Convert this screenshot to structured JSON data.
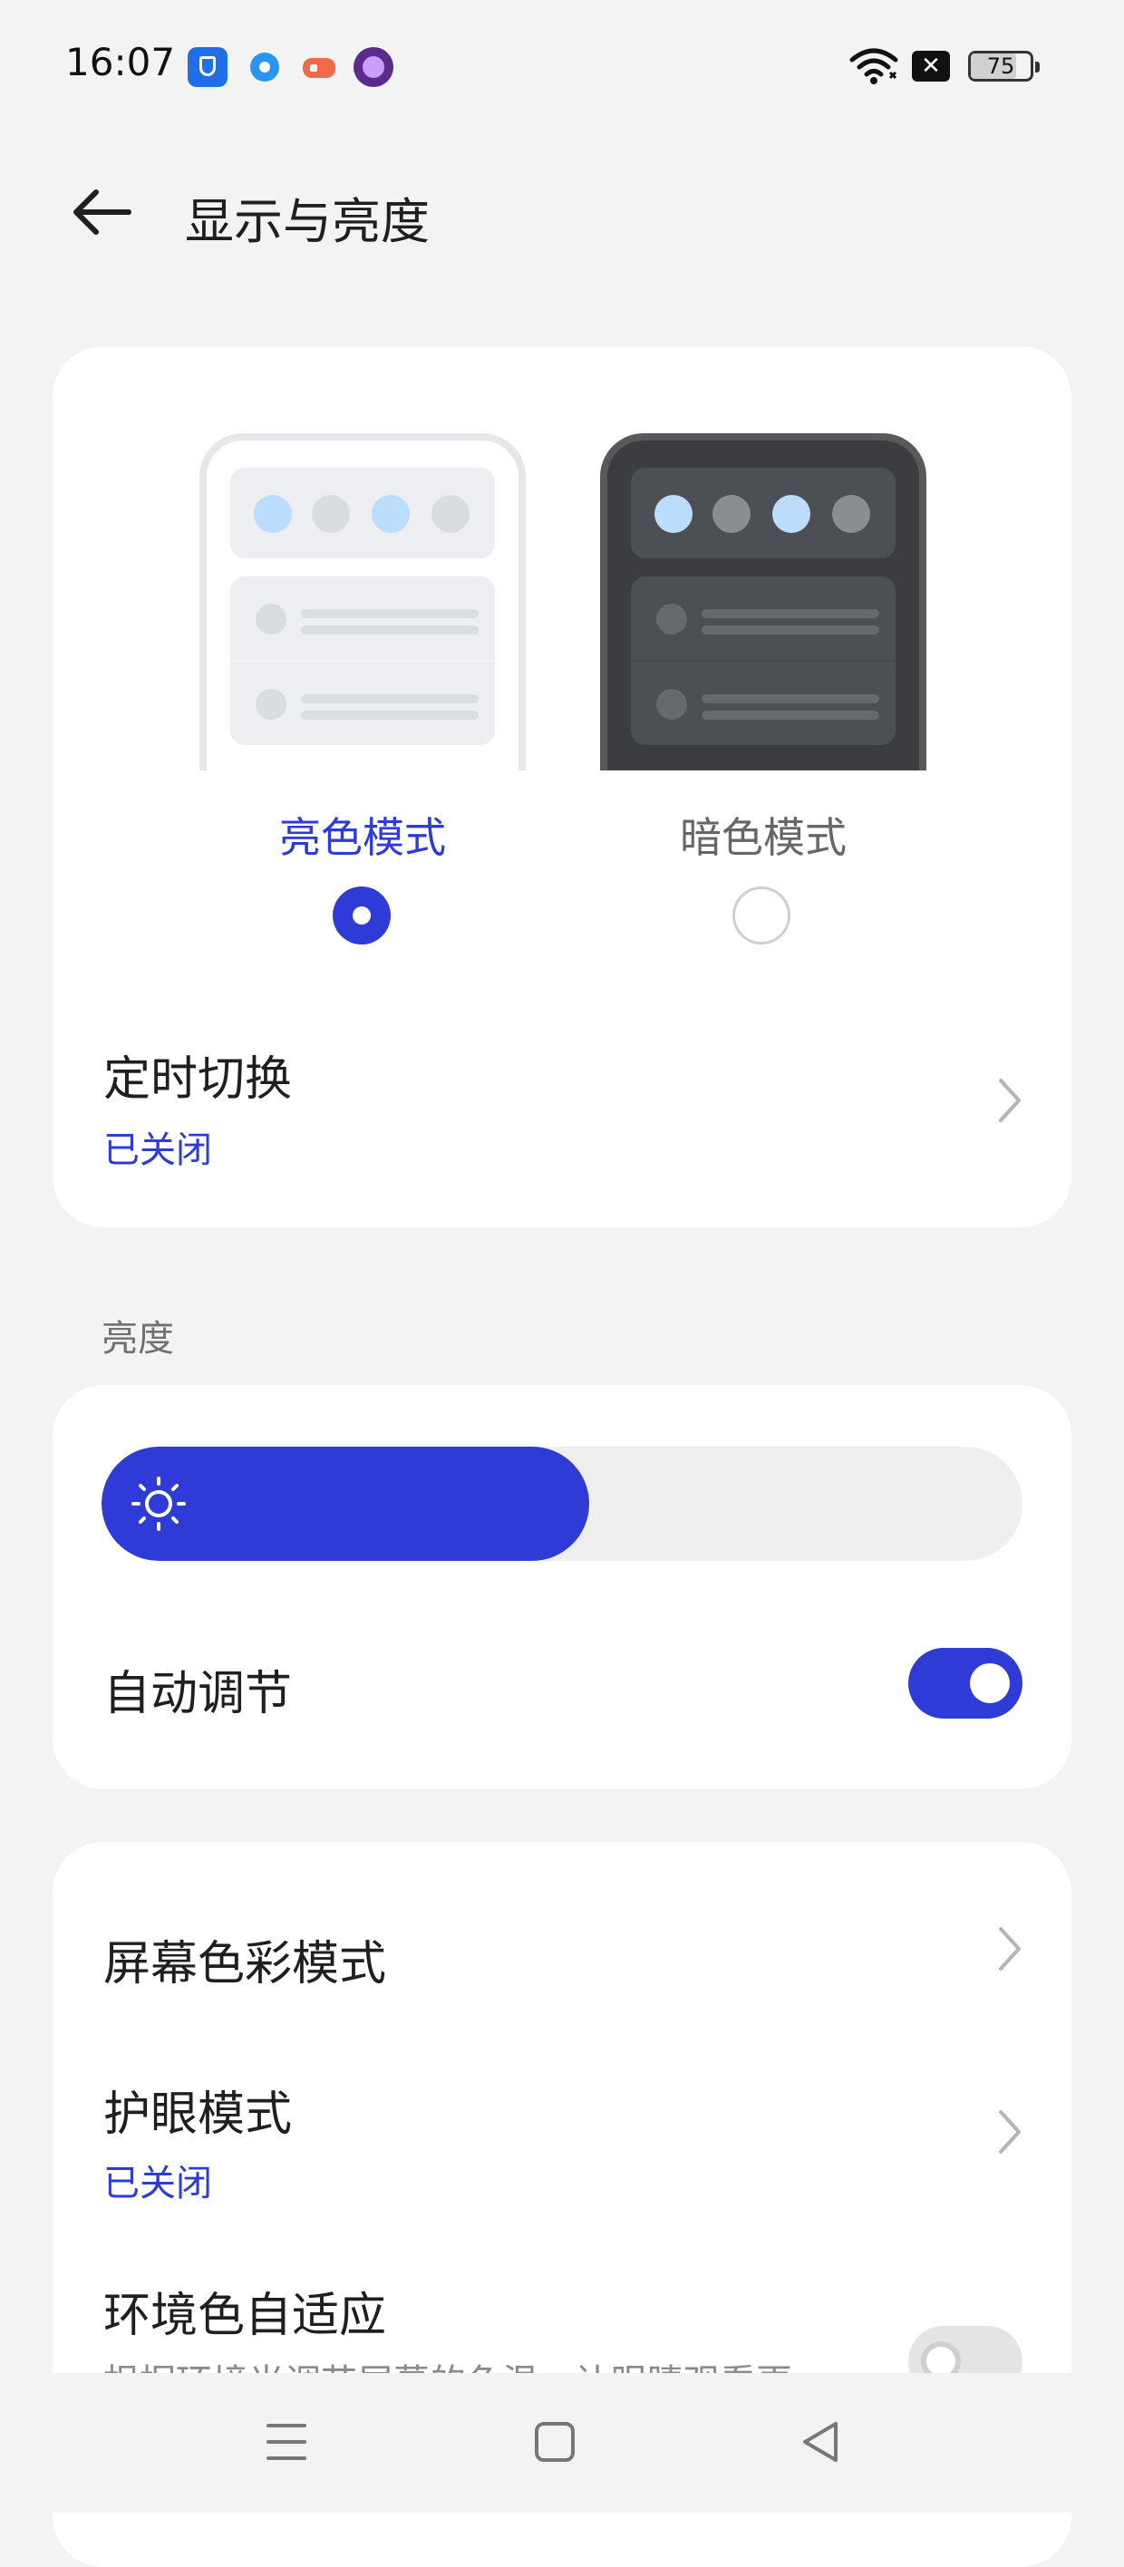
{
  "status_bar": {
    "time": "16:07",
    "battery": 75,
    "battery_label": "75",
    "notification_icons": [
      "security-shield-icon",
      "browser-ring-icon",
      "game-controller-icon",
      "orb-app-icon"
    ],
    "wifi_icon": "wifi-icon",
    "x_icon": "close-badge-icon"
  },
  "header": {
    "back_icon": "back-arrow-icon",
    "title": "显示与亮度"
  },
  "appearance": {
    "light_label": "亮色模式",
    "dark_label": "暗色模式",
    "selected": "light"
  },
  "schedule": {
    "title": "定时切换",
    "subtitle": "已关闭"
  },
  "brightness": {
    "section_label": "亮度",
    "level": 0.53,
    "auto_label": "自动调节",
    "auto_enabled": true
  },
  "display_settings": {
    "color_mode_title": "屏幕色彩模式",
    "eye_comfort_title": "护眼模式",
    "eye_comfort_subtitle": "已关闭",
    "ambient_title": "环境色自适应",
    "ambient_desc": "根据环境光调节屏幕的色温，让眼睛观看更",
    "ambient_enabled": false
  },
  "nav_bar": {
    "icons": [
      "menu-icon",
      "home-icon",
      "back-triangle-icon"
    ]
  },
  "colors": {
    "accent": "#2f3bd6",
    "background": "#f3f3f3",
    "card": "#ffffff"
  }
}
